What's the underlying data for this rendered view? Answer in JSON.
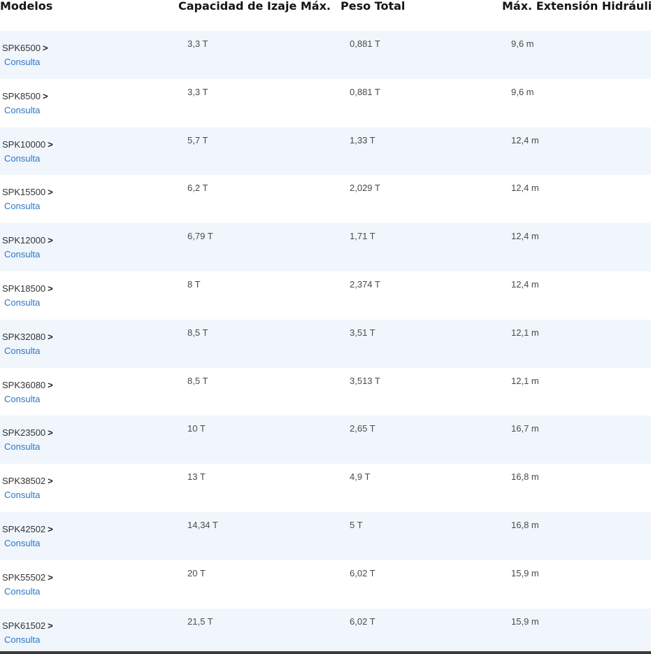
{
  "table": {
    "headers": {
      "model": "Modelos",
      "capacity": "Capacidad de Izaje Máx.",
      "weight": "Peso Total",
      "extension": "Máx. Extensión Hidráulica"
    },
    "link_label": "Consulta",
    "chevron": ">",
    "rows": [
      {
        "model": "SPK6500",
        "capacity": "3,3 T",
        "weight": "0,881 T",
        "extension": "9,6 m"
      },
      {
        "model": "SPK8500",
        "capacity": "3,3 T",
        "weight": "0,881 T",
        "extension": "9,6 m"
      },
      {
        "model": "SPK10000",
        "capacity": "5,7 T",
        "weight": "1,33 T",
        "extension": "12,4 m"
      },
      {
        "model": "SPK15500",
        "capacity": "6,2 T",
        "weight": "2,029 T",
        "extension": "12,4 m"
      },
      {
        "model": "SPK12000",
        "capacity": "6,79 T",
        "weight": "1,71 T",
        "extension": "12,4 m"
      },
      {
        "model": "SPK18500",
        "capacity": "8 T",
        "weight": "2,374 T",
        "extension": "12,4 m"
      },
      {
        "model": "SPK32080",
        "capacity": "8,5 T",
        "weight": "3,51 T",
        "extension": "12,1 m"
      },
      {
        "model": "SPK36080",
        "capacity": "8,5 T",
        "weight": "3,513 T",
        "extension": "12,1 m"
      },
      {
        "model": "SPK23500",
        "capacity": "10 T",
        "weight": "2,65 T",
        "extension": "16,7 m"
      },
      {
        "model": "SPK38502",
        "capacity": "13 T",
        "weight": "4,9 T",
        "extension": "16,8 m"
      },
      {
        "model": "SPK42502",
        "capacity": "14,34 T",
        "weight": "5 T",
        "extension": "16,8 m"
      },
      {
        "model": "SPK55502",
        "capacity": "20 T",
        "weight": "6,02 T",
        "extension": "15,9 m"
      },
      {
        "model": "SPK61502",
        "capacity": "21,5 T",
        "weight": "6,02 T",
        "extension": "15,9 m"
      }
    ]
  },
  "colors": {
    "row_alt": "#f1f6fc",
    "link": "#2a77c7",
    "header_text": "#151515"
  }
}
